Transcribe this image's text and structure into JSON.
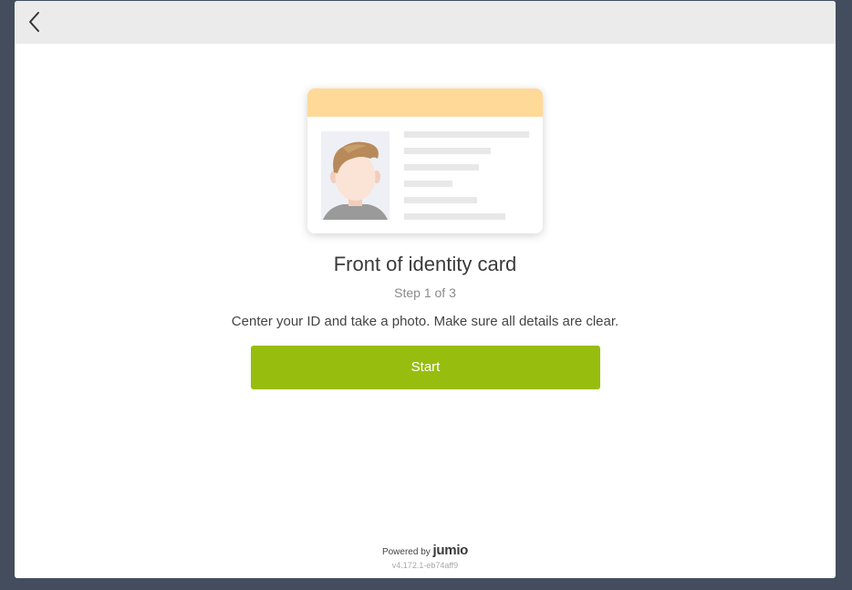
{
  "topbar": {
    "back_icon": "chevron-left-icon"
  },
  "illustration": {
    "header_color": "#fed998",
    "photo_icon": "person-avatar-icon"
  },
  "main": {
    "title": "Front of identity card",
    "step": "Step 1 of 3",
    "description": "Center your ID and take a photo. Make sure all details are clear.",
    "start_label": "Start",
    "accent_color": "#97bd0e"
  },
  "footer": {
    "powered_by": "Powered by",
    "brand": "jumio",
    "version": "v4.172.1-eb74aff9"
  }
}
